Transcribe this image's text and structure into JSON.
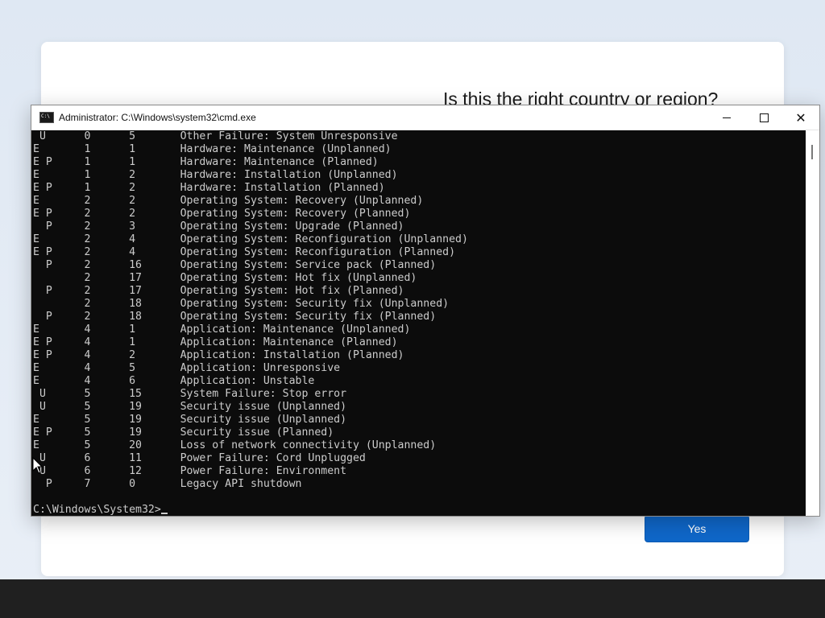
{
  "oobe": {
    "title": "Is this the right country or region?",
    "yes_label": "Yes"
  },
  "cmd": {
    "title": "Administrator: C:\\Windows\\system32\\cmd.exe",
    "lines": [
      " U      0      5       Other Failure: System Unresponsive",
      "E       1      1       Hardware: Maintenance (Unplanned)",
      "E P     1      1       Hardware: Maintenance (Planned)",
      "E       1      2       Hardware: Installation (Unplanned)",
      "E P     1      2       Hardware: Installation (Planned)",
      "E       2      2       Operating System: Recovery (Unplanned)",
      "E P     2      2       Operating System: Recovery (Planned)",
      "  P     2      3       Operating System: Upgrade (Planned)",
      "E       2      4       Operating System: Reconfiguration (Unplanned)",
      "E P     2      4       Operating System: Reconfiguration (Planned)",
      "  P     2      16      Operating System: Service pack (Planned)",
      "        2      17      Operating System: Hot fix (Unplanned)",
      "  P     2      17      Operating System: Hot fix (Planned)",
      "        2      18      Operating System: Security fix (Unplanned)",
      "  P     2      18      Operating System: Security fix (Planned)",
      "E       4      1       Application: Maintenance (Unplanned)",
      "E P     4      1       Application: Maintenance (Planned)",
      "E P     4      2       Application: Installation (Planned)",
      "E       4      5       Application: Unresponsive",
      "E       4      6       Application: Unstable",
      " U      5      15      System Failure: Stop error",
      " U      5      19      Security issue (Unplanned)",
      "E       5      19      Security issue (Unplanned)",
      "E P     5      19      Security issue (Planned)",
      "E       5      20      Loss of network connectivity (Unplanned)",
      " U      6      11      Power Failure: Cord Unplugged",
      " U      6      12      Power Failure: Environment",
      "  P     7      0       Legacy API shutdown",
      ""
    ],
    "prompt": "C:\\Windows\\System32>"
  }
}
